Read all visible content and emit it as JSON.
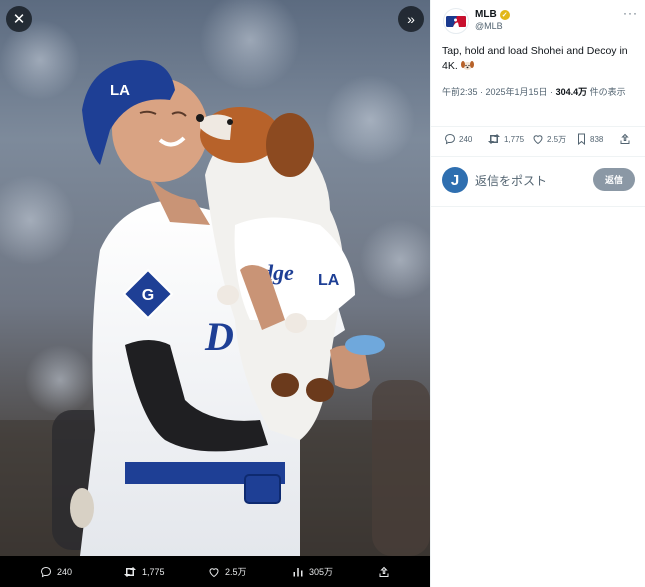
{
  "viewer": {
    "close_icon": "close-icon",
    "expand_icon": "chevron-double-right-icon",
    "photo_description_icon": "photo",
    "bar": {
      "replies": "240",
      "reposts": "1,775",
      "likes": "2.5万",
      "views": "305万"
    }
  },
  "tweet": {
    "author_name": "MLB",
    "author_handle": "@MLB",
    "text": "Tap, hold and load Shohei and Decoy in 4K.",
    "time": "午前2:35 · 2025年1月15日 · ",
    "views_count": "304.4万",
    "views_suffix": " 件の表示",
    "stats": {
      "replies": "240",
      "reposts": "1,775",
      "likes": "2.5万",
      "bookmarks": "838"
    }
  },
  "reply": {
    "avatar_letter": "J",
    "placeholder": "返信をポスト",
    "button_label": "返信"
  },
  "colors": {
    "dodgers_blue": "#1e3f95",
    "verified_gold": "#e2b719",
    "reply_button": "#8b98a5"
  }
}
